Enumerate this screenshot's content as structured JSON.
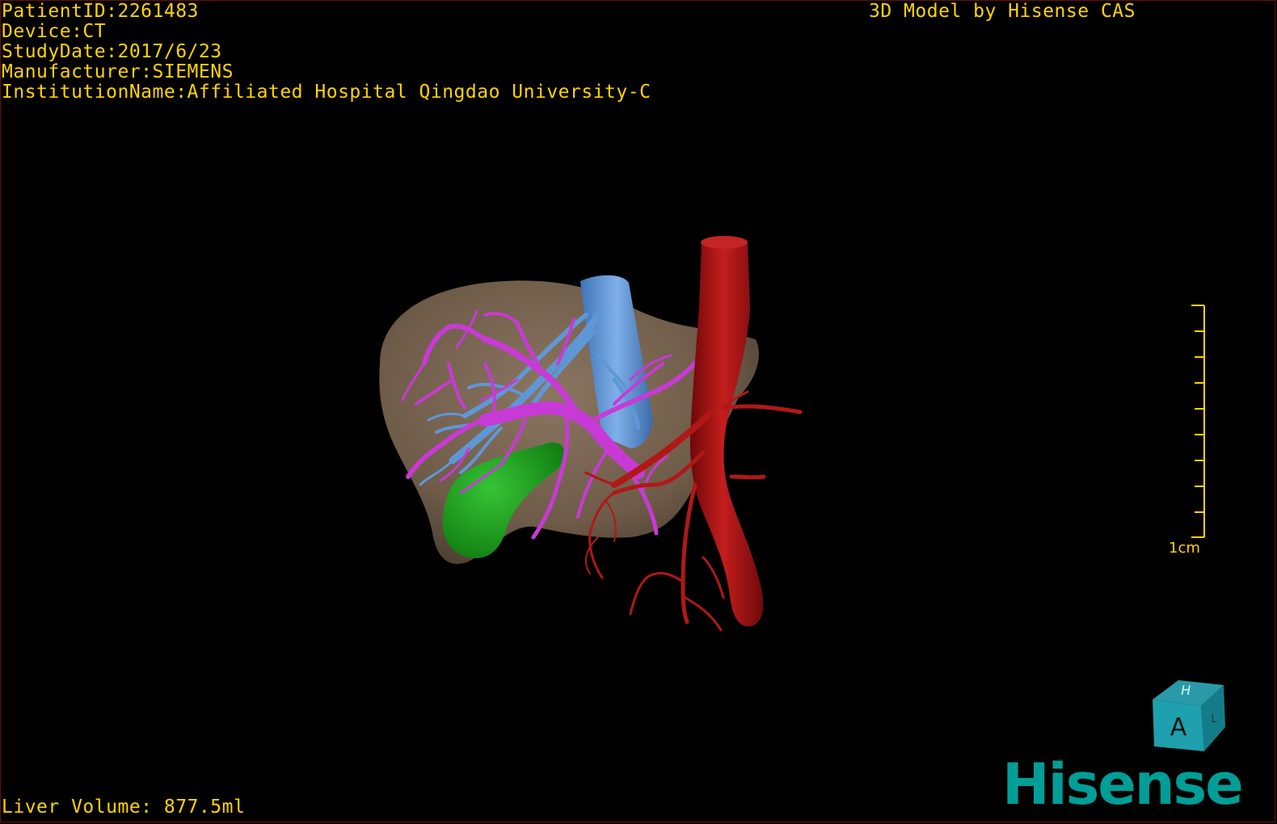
{
  "header": {
    "patient_id": "PatientID:2261483",
    "device": "Device:CT",
    "study_date": "StudyDate:2017/6/23",
    "manufacturer": "Manufacturer:SIEMENS",
    "institution": "InstitutionName:Affiliated Hospital Qingdao University-C"
  },
  "credit": "3D Model by Hisense CAS",
  "volume": "Liver Volume: 877.5ml",
  "scale": {
    "label": "1cm"
  },
  "orientation_cube": {
    "top_face": "H",
    "front_face": "A",
    "side_face": "L"
  },
  "logo": {
    "text": "Hisense"
  },
  "colors": {
    "overlay_text": "#ffd400",
    "liver": "#7a6652",
    "portal_vein": "#c83ad6",
    "hepatic_vein": "#5f97d6",
    "artery": "#b01818",
    "gallbladder": "#1aa01a",
    "logo": "#009e96"
  }
}
